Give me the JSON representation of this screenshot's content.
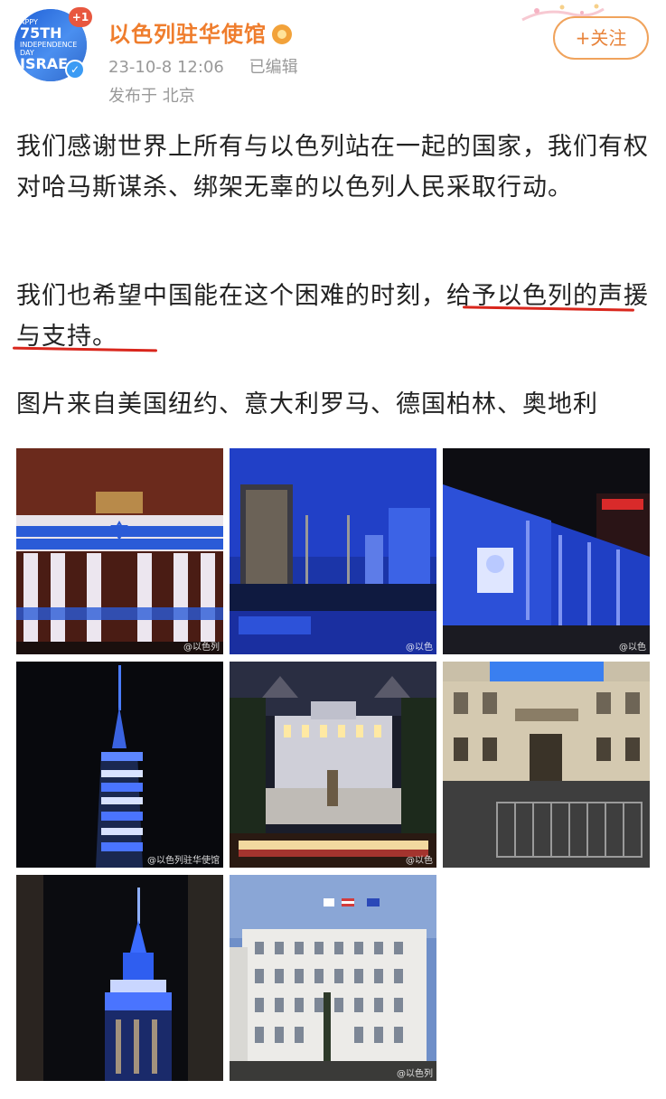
{
  "post": {
    "author_name": "以色列驻华使馆",
    "timestamp": "23-10-8 12:06",
    "edited_label": "已编辑",
    "location": "发布于 北京",
    "follow_label": "+关注",
    "avatar": {
      "badge_count": "+1",
      "line1": "APPY",
      "line2": "75TH",
      "line3": "INDEPENDENCE",
      "line4": "DAY",
      "line5": "ISRAE"
    },
    "paragraph1": "我们感谢世界上所有与以色列站在一起的国家，我们有权对哈马斯谋杀、绑架无辜的以色列人民采取行动。",
    "paragraph2": "我们也希望中国能在这个困难的时刻，给予以色列的声援与支持。",
    "paragraph3": "图片来自美国纽约、意大利罗马、德国柏林、奥地利"
  },
  "images": [
    {
      "name": "brandenburg-gate",
      "watermark": "@以色列"
    },
    {
      "name": "skyline-blue",
      "watermark": "@以色"
    },
    {
      "name": "museum-blue",
      "watermark": "@以色"
    },
    {
      "name": "one-world-trade-center",
      "watermark": "@以色列驻华使馆"
    },
    {
      "name": "capitol-building",
      "watermark": "@以色"
    },
    {
      "name": "palazzo-rome",
      "watermark": ""
    },
    {
      "name": "empire-state-building",
      "watermark": ""
    },
    {
      "name": "vienna-building",
      "watermark": "@以色列"
    }
  ],
  "colors": {
    "author_orange": "#ef7d2d",
    "follow_border": "#f0a35c",
    "underline_red": "#d9261c",
    "meta_gray": "#999999",
    "israel_blue": "#2a5bd7"
  }
}
